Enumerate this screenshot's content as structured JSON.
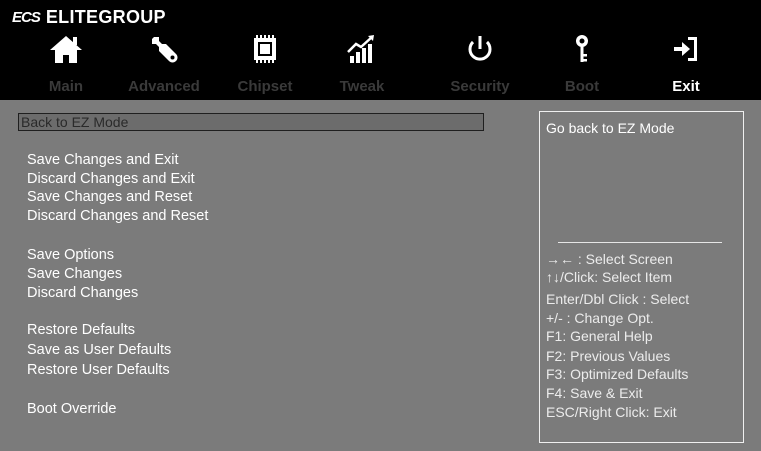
{
  "brand": {
    "logo": "ECS",
    "name": "ELITEGROUP"
  },
  "tabs": [
    {
      "label": "Main",
      "icon": "home-icon",
      "active": false
    },
    {
      "label": "Advanced",
      "icon": "wrench-icon",
      "active": false
    },
    {
      "label": "Chipset",
      "icon": "chip-icon",
      "active": false
    },
    {
      "label": "Tweak",
      "icon": "performance-chart-icon",
      "active": false
    },
    {
      "label": "Security",
      "icon": "power-icon",
      "active": false
    },
    {
      "label": "Boot",
      "icon": "key-icon",
      "active": false
    },
    {
      "label": "Exit",
      "icon": "exit-icon",
      "active": true
    }
  ],
  "main": {
    "selected_item": "Back to EZ Mode",
    "items": [
      "Save Changes and Exit",
      "Discard Changes and Exit",
      "Save Changes and Reset",
      "Discard Changes and Reset",
      "Save Options",
      "Save Changes",
      "Discard Changes",
      "Restore Defaults",
      "Save as User Defaults",
      "Restore User Defaults",
      "Boot Override"
    ]
  },
  "help": {
    "description": "Go back to EZ Mode",
    "keys": [
      "→← : Select Screen",
      "↑↓/Click: Select Item",
      "Enter/Dbl Click : Select",
      "+/- : Change Opt.",
      "F1: General Help",
      "F2: Previous Values",
      "F3: Optimized Defaults",
      "F4: Save & Exit",
      "ESC/Right Click: Exit"
    ]
  },
  "colors": {
    "background": "#7b7b7b",
    "topbar": "#000000",
    "tab_inactive": "#3a3a3a",
    "tab_active": "#ffffff",
    "text": "#ffffff"
  }
}
